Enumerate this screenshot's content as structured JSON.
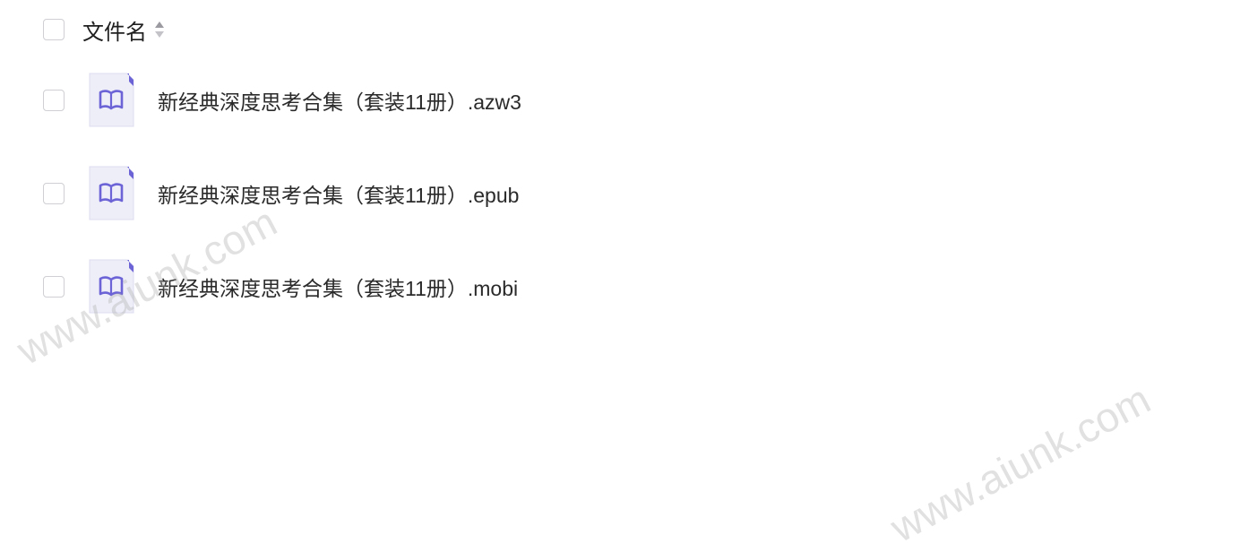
{
  "header": {
    "label": "文件名",
    "sort_icon": "sort-icon"
  },
  "files": [
    {
      "name": "新经典深度思考合集（套装11册）.azw3",
      "icon": "book-icon"
    },
    {
      "name": "新经典深度思考合集（套装11册）.epub",
      "icon": "book-icon"
    },
    {
      "name": "新经典深度思考合集（套装11册）.mobi",
      "icon": "book-icon"
    }
  ],
  "watermarks": [
    "www.aiunk.com",
    "www.aiunk.com"
  ],
  "colors": {
    "accent": "#6b63d6",
    "icon_bg": "#eeeef9",
    "checkbox_border": "#cfcfd4",
    "watermark": "#aaaaaa"
  }
}
